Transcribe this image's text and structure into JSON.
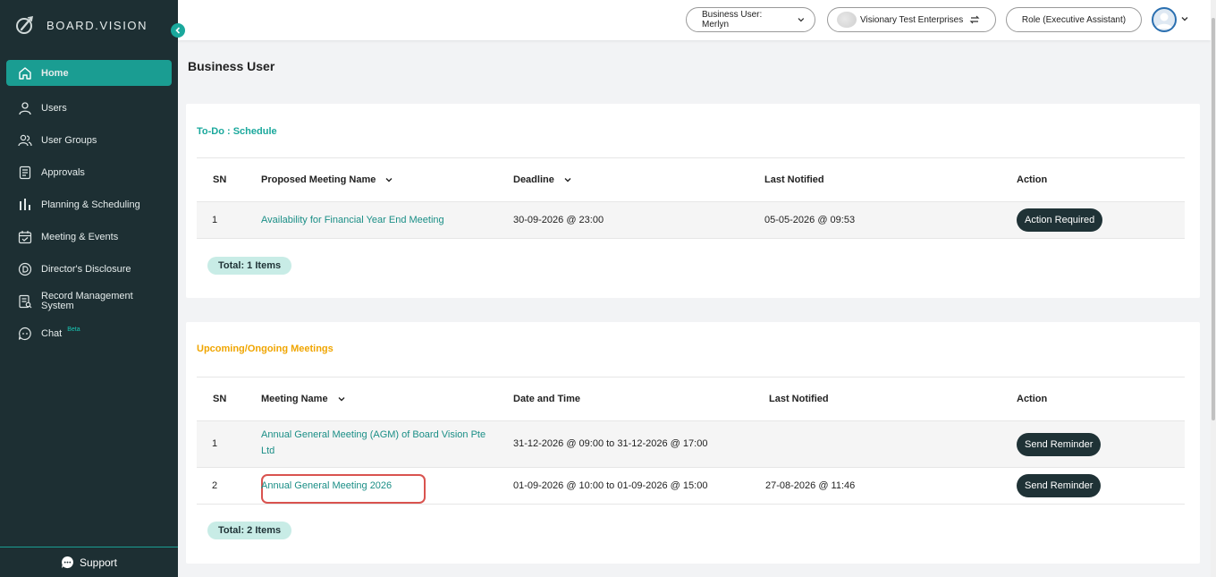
{
  "app": {
    "brand": "BOARD.VISION"
  },
  "sidebar": {
    "items": [
      {
        "label": "Home",
        "icon": "home-icon"
      },
      {
        "label": "Users",
        "icon": "user-icon"
      },
      {
        "label": "User Groups",
        "icon": "users-icon"
      },
      {
        "label": "Approvals",
        "icon": "document-icon"
      },
      {
        "label": "Planning & Scheduling",
        "icon": "bar-chart-icon"
      },
      {
        "label": "Meeting & Events",
        "icon": "calendar-check-icon"
      },
      {
        "label": "Director's Disclosure",
        "icon": "d-circle-icon"
      },
      {
        "label": "Record Management System",
        "icon": "record-icon"
      },
      {
        "label": "Chat",
        "icon": "chat-icon",
        "badge": "Beta"
      }
    ],
    "support_label": "Support"
  },
  "topbar": {
    "user_selector": "Business User: Merlyn",
    "company": "Visionary Test Enterprises",
    "role": "Role (Executive Assistant)"
  },
  "page": {
    "title": "Business User"
  },
  "todo": {
    "title": "To-Do : Schedule",
    "headers": {
      "sn": "SN",
      "name": "Proposed Meeting Name",
      "deadline": "Deadline",
      "last_notified": "Last Notified",
      "action": "Action"
    },
    "rows": [
      {
        "sn": "1",
        "name": "Availability for Financial Year End Meeting",
        "deadline": "30-09-2026 @ 23:00",
        "last_notified": "05-05-2026 @ 09:53",
        "action": "Action Required"
      }
    ],
    "total": "Total: 1 Items"
  },
  "meetings": {
    "title": "Upcoming/Ongoing Meetings",
    "headers": {
      "sn": "SN",
      "name": "Meeting Name",
      "datetime": "Date and Time",
      "last_notified": "Last Notified",
      "action": "Action"
    },
    "rows": [
      {
        "sn": "1",
        "name": "Annual General Meeting (AGM) of Board Vision Pte Ltd",
        "datetime": "31-12-2026 @ 09:00 to 31-12-2026 @ 17:00",
        "last_notified": "",
        "action": "Send Reminder"
      },
      {
        "sn": "2",
        "name": "Annual General Meeting 2026",
        "datetime": "01-09-2026 @ 10:00 to 01-09-2026 @ 15:00",
        "last_notified": "27-08-2026 @ 11:46",
        "action": "Send Reminder"
      }
    ],
    "total": "Total: 2 Items"
  },
  "colors": {
    "sidebar_bg": "#1d2f33",
    "accent": "#1aa89c",
    "orange": "#f0a500",
    "highlight": "#d9534f"
  }
}
